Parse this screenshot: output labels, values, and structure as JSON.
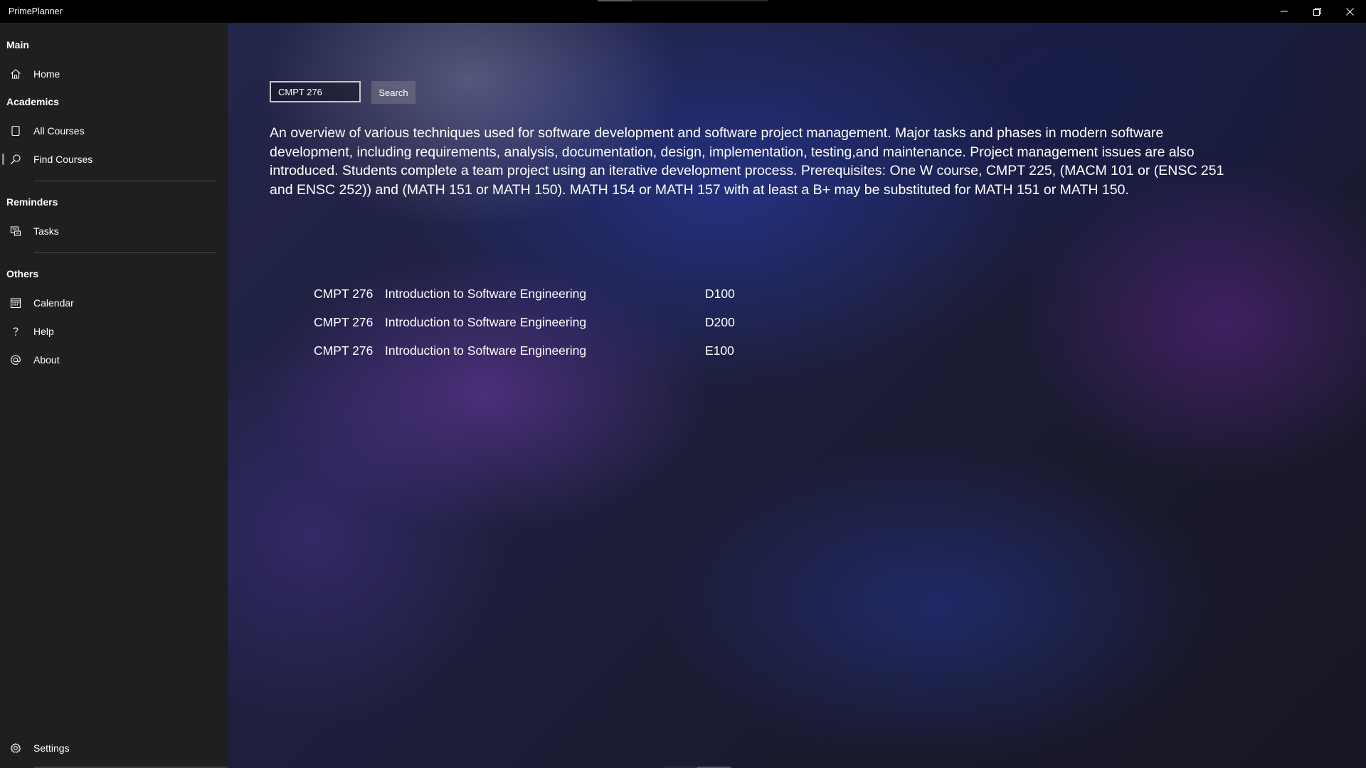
{
  "app": {
    "title": "PrimePlanner"
  },
  "window_controls": {
    "minimize_icon": "minimize-icon",
    "restore_icon": "restore-icon",
    "close_icon": "close-icon"
  },
  "sidebar": {
    "sections": {
      "main": "Main",
      "academics": "Academics",
      "reminders": "Reminders",
      "others": "Others"
    },
    "items": [
      {
        "label": "Home",
        "icon": "home-icon"
      },
      {
        "label": "All Courses",
        "icon": "tablet-icon"
      },
      {
        "label": "Find Courses",
        "icon": "search-icon",
        "selected": true
      },
      {
        "label": "Tasks",
        "icon": "tasks-icon"
      },
      {
        "label": "Calendar",
        "icon": "calendar-icon"
      },
      {
        "label": "Help",
        "icon": "help-icon"
      },
      {
        "label": "About",
        "icon": "at-icon"
      },
      {
        "label": "Settings",
        "icon": "gear-icon"
      }
    ]
  },
  "search": {
    "value": "CMPT 276",
    "button_label": "Search"
  },
  "course_description": "An overview of various techniques used for software development and software project management. Major tasks and phases in modern software development, including requirements, analysis, documentation, design, implementation, testing,and maintenance. Project management issues are also introduced. Students complete a team project using an iterative development process. Prerequisites: One W course, CMPT 225, (MACM 101 or (ENSC 251 and ENSC 252)) and (MATH 151 or MATH 150). MATH 154 or MATH 157 with at least a B+ may be substituted for MATH 151 or MATH 150.",
  "results": [
    {
      "code": "CMPT 276",
      "name": "Introduction to Software Engineering",
      "section": "D100"
    },
    {
      "code": "CMPT 276",
      "name": "Introduction to Software Engineering",
      "section": "D200"
    },
    {
      "code": "CMPT 276",
      "name": "Introduction to Software Engineering",
      "section": "E100"
    }
  ],
  "colors": {
    "titlebar": "#000000",
    "sidebar": "#1f1f1f",
    "text": "#ffffff"
  }
}
